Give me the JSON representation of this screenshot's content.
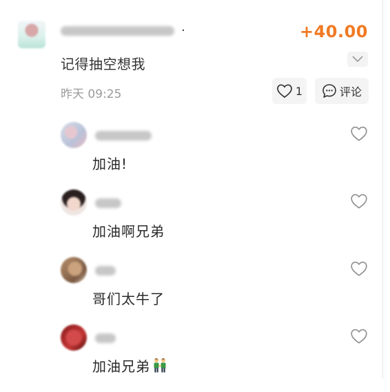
{
  "post": {
    "amount": "+40.00",
    "message": "记得抽空想我",
    "time": "昨天 09:25",
    "like_count": "1",
    "comment_label": "评论",
    "name_separator": "·"
  },
  "comments": [
    {
      "text": "加油!",
      "emoji": ""
    },
    {
      "text": "加油啊兄弟",
      "emoji": ""
    },
    {
      "text": "哥们太牛了",
      "emoji": ""
    },
    {
      "text": "加油兄弟",
      "emoji": "two-men-holding-hands"
    }
  ],
  "colors": {
    "amount": "#f07a24",
    "text": "#333333",
    "muted": "#9a9a9a",
    "button_bg": "#f4f4f4"
  },
  "icons": [
    "chevron-down-icon",
    "heart-outline-icon",
    "comment-bubble-icon",
    "two-men-holding-hands-emoji"
  ]
}
